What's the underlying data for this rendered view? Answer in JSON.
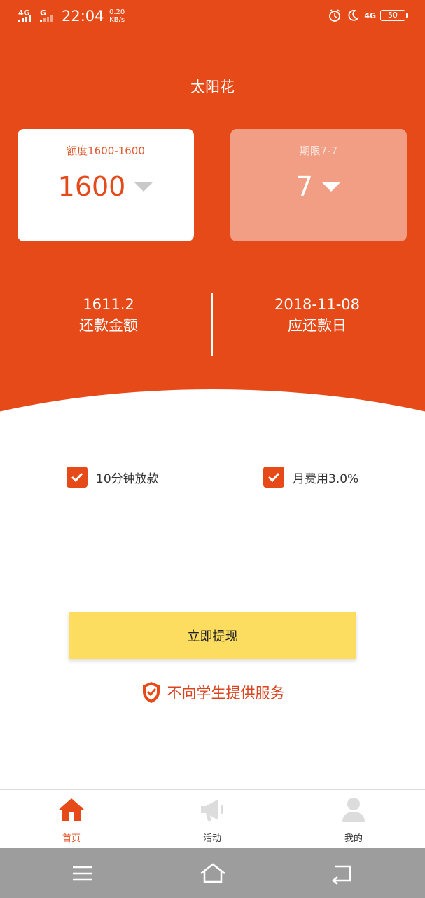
{
  "status_bar": {
    "network_1": "4G",
    "network_2": "G",
    "time": "22:04",
    "speed_value": "0.20",
    "speed_unit": "KB/s",
    "network_right": "4G",
    "battery": "50"
  },
  "header": {
    "title": "太阳花"
  },
  "amount_card": {
    "label": "额度1600-1600",
    "value": "1600"
  },
  "term_card": {
    "label": "期限7-7",
    "value": "7"
  },
  "summary": {
    "repay_amount": "1611.2",
    "repay_amount_label": "还款金额",
    "due_date": "2018-11-08",
    "due_date_label": "应还款日"
  },
  "features": [
    {
      "label": "10分钟放款",
      "checked": true
    },
    {
      "label": "月费用3.0%",
      "checked": true
    }
  ],
  "actions": {
    "withdraw_label": "立即提现"
  },
  "notice": {
    "text": "不向学生提供服务"
  },
  "tabs": [
    {
      "label": "首页",
      "icon": "home-icon",
      "active": true
    },
    {
      "label": "活动",
      "icon": "megaphone-icon",
      "active": false
    },
    {
      "label": "我的",
      "icon": "person-icon",
      "active": false
    }
  ],
  "colors": {
    "primary": "#e64a19",
    "button": "#fcdd5f",
    "term_card_bg": "#f29e84",
    "nav_bar": "#9d9d9d"
  }
}
